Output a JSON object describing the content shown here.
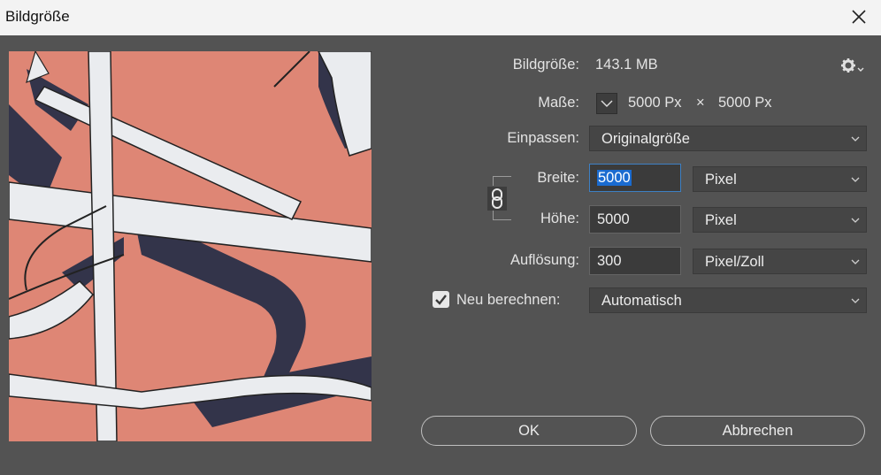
{
  "window": {
    "title": "Bildgröße"
  },
  "info": {
    "label": "Bildgröße:",
    "value": "143.1 MB"
  },
  "dimensions": {
    "label": "Maße:",
    "width_text": "5000 Px",
    "times": "×",
    "height_text": "5000 Px"
  },
  "fit": {
    "label": "Einpassen:",
    "value": "Originalgröße"
  },
  "width": {
    "label": "Breite:",
    "value": "5000",
    "unit": "Pixel"
  },
  "height": {
    "label": "Höhe:",
    "value": "5000",
    "unit": "Pixel"
  },
  "resolution": {
    "label": "Auflösung:",
    "value": "300",
    "unit": "Pixel/Zoll"
  },
  "resample": {
    "label": "Neu berechnen:",
    "checked": true,
    "value": "Automatisch"
  },
  "buttons": {
    "ok": "OK",
    "cancel": "Abbrechen"
  },
  "icons": {
    "close": "close-icon",
    "gear": "gear-icon",
    "dims": "chevron-down-icon",
    "link": "link-icon",
    "check": "checkmark-icon"
  },
  "colors": {
    "background": "#535353",
    "control": "#454545",
    "accent": "#1a6bd0",
    "preview_salmon": "#de8675",
    "preview_navy": "#33344a",
    "preview_white": "#eaecef"
  }
}
